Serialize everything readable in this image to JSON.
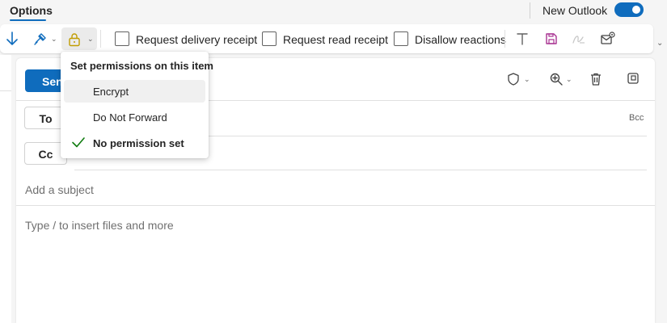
{
  "tabs": {
    "options_label": "Options"
  },
  "header": {
    "new_outlook_label": "New Outlook",
    "new_outlook_enabled": true
  },
  "toolbar": {
    "icons": [
      "arrow-down-icon",
      "paint-brush-icon",
      "lock-icon",
      "text-format-icon",
      "save-icon",
      "signature-icon",
      "mail-settings-icon"
    ],
    "delivery_receipt_label": "Request delivery receipt",
    "read_receipt_label": "Request read receipt",
    "disallow_reactions_label": "Disallow reactions"
  },
  "compose": {
    "send_label": "Send",
    "to_label": "To",
    "cc_label": "Cc",
    "bcc_label": "Bcc",
    "subject_placeholder": "Add a subject",
    "body_placeholder": "Type / to insert files and more"
  },
  "permissions_menu": {
    "title": "Set permissions on this item",
    "items": [
      {
        "label": "Encrypt",
        "checked": false
      },
      {
        "label": "Do Not Forward",
        "checked": false
      },
      {
        "label": "No permission set",
        "checked": true
      }
    ]
  },
  "colors": {
    "accent": "#0f6cbd",
    "check": "#107c10",
    "save_icon": "#a83291"
  }
}
